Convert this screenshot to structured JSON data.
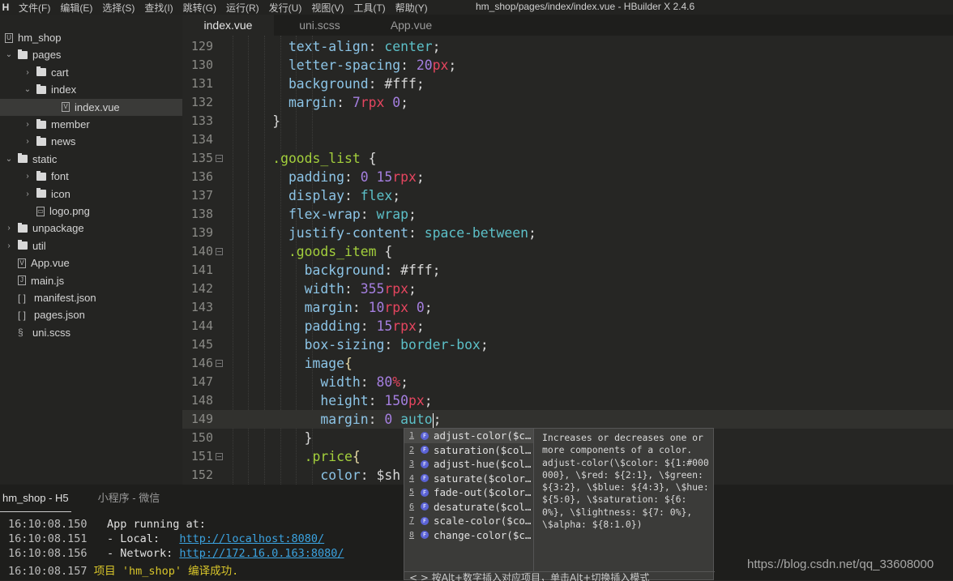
{
  "menubar": {
    "logo": "H",
    "items": [
      "文件(F)",
      "编辑(E)",
      "选择(S)",
      "查找(I)",
      "跳转(G)",
      "运行(R)",
      "发行(U)",
      "视图(V)",
      "工具(T)",
      "帮助(Y)"
    ],
    "title": "hm_shop/pages/index/index.vue - HBuilder X 2.4.6"
  },
  "sidebar": {
    "items": [
      {
        "label": "hm_shop",
        "icon": "project-icon",
        "level": 0,
        "chevron": "",
        "selected": false
      },
      {
        "label": "pages",
        "icon": "folder-open-icon",
        "level": 0,
        "chevron": "down"
      },
      {
        "label": "cart",
        "icon": "folder-icon",
        "level": 1,
        "chevron": "right"
      },
      {
        "label": "index",
        "icon": "folder-open-icon",
        "level": 1,
        "chevron": "down"
      },
      {
        "label": "index.vue",
        "icon": "vue-file-icon",
        "level": 2,
        "chevron": "",
        "selected": true
      },
      {
        "label": "member",
        "icon": "folder-icon",
        "level": 1,
        "chevron": "right"
      },
      {
        "label": "news",
        "icon": "folder-icon",
        "level": 1,
        "chevron": "right"
      },
      {
        "label": "static",
        "icon": "folder-open-icon",
        "level": 0,
        "chevron": "down"
      },
      {
        "label": "font",
        "icon": "folder-icon",
        "level": 1,
        "chevron": "right"
      },
      {
        "label": "icon",
        "icon": "folder-icon",
        "level": 1,
        "chevron": "right"
      },
      {
        "label": "logo.png",
        "icon": "image-file-icon",
        "level": 1,
        "chevron": ""
      },
      {
        "label": "unpackage",
        "icon": "folder-icon",
        "level": 0,
        "chevron": "right"
      },
      {
        "label": "util",
        "icon": "folder-icon",
        "level": 0,
        "chevron": "right"
      },
      {
        "label": "App.vue",
        "icon": "vue-file-icon",
        "level": 0,
        "chevron": ""
      },
      {
        "label": "main.js",
        "icon": "js-file-icon",
        "level": 0,
        "chevron": ""
      },
      {
        "label": "manifest.json",
        "icon": "json-file-icon",
        "level": 0,
        "chevron": ""
      },
      {
        "label": "pages.json",
        "icon": "json-file-icon",
        "level": 0,
        "chevron": ""
      },
      {
        "label": "uni.scss",
        "icon": "scss-file-icon",
        "level": 0,
        "chevron": ""
      }
    ]
  },
  "tabs": [
    {
      "label": "index.vue",
      "active": true
    },
    {
      "label": "uni.scss"
    },
    {
      "label": "App.vue"
    }
  ],
  "editor": {
    "current_line": 149,
    "lines": [
      {
        "n": 129,
        "t": [
          [
            "prop",
            "        text-align"
          ],
          [
            "punc",
            ": "
          ],
          [
            "val",
            "center"
          ],
          [
            "punc",
            ";"
          ]
        ]
      },
      {
        "n": 130,
        "t": [
          [
            "prop",
            "        letter-spacing"
          ],
          [
            "punc",
            ": "
          ],
          [
            "num",
            "20"
          ],
          [
            "unit",
            "px"
          ],
          [
            "punc",
            ";"
          ]
        ]
      },
      {
        "n": 131,
        "t": [
          [
            "prop",
            "        background"
          ],
          [
            "punc",
            ": #fff;"
          ]
        ]
      },
      {
        "n": 132,
        "t": [
          [
            "prop",
            "        margin"
          ],
          [
            "punc",
            ": "
          ],
          [
            "num",
            "7"
          ],
          [
            "unit",
            "rpx"
          ],
          [
            "num",
            " 0"
          ],
          [
            "punc",
            ";"
          ]
        ]
      },
      {
        "n": 133,
        "t": [
          [
            "plain",
            "      }"
          ]
        ]
      },
      {
        "n": 134,
        "t": []
      },
      {
        "n": 135,
        "fold": true,
        "t": [
          [
            "sel",
            "      .goods_list"
          ],
          [
            "plain",
            " {"
          ]
        ]
      },
      {
        "n": 136,
        "t": [
          [
            "prop",
            "        padding"
          ],
          [
            "punc",
            ": "
          ],
          [
            "num",
            "0 15"
          ],
          [
            "unit",
            "rpx"
          ],
          [
            "punc",
            ";"
          ]
        ]
      },
      {
        "n": 137,
        "t": [
          [
            "prop",
            "        display"
          ],
          [
            "punc",
            ": "
          ],
          [
            "val",
            "flex"
          ],
          [
            "punc",
            ";"
          ]
        ]
      },
      {
        "n": 138,
        "t": [
          [
            "prop",
            "        flex-wrap"
          ],
          [
            "punc",
            ": "
          ],
          [
            "val",
            "wrap"
          ],
          [
            "punc",
            ";"
          ]
        ]
      },
      {
        "n": 139,
        "t": [
          [
            "prop",
            "        justify-content"
          ],
          [
            "punc",
            ": "
          ],
          [
            "val",
            "space-between"
          ],
          [
            "punc",
            ";"
          ]
        ]
      },
      {
        "n": 140,
        "fold": true,
        "t": [
          [
            "sel",
            "        .goods_item"
          ],
          [
            "plain",
            " {"
          ]
        ]
      },
      {
        "n": 141,
        "t": [
          [
            "prop",
            "          background"
          ],
          [
            "punc",
            ": #fff;"
          ]
        ]
      },
      {
        "n": 142,
        "t": [
          [
            "prop",
            "          width"
          ],
          [
            "punc",
            ": "
          ],
          [
            "num",
            "355"
          ],
          [
            "unit",
            "rpx"
          ],
          [
            "punc",
            ";"
          ]
        ]
      },
      {
        "n": 143,
        "t": [
          [
            "prop",
            "          margin"
          ],
          [
            "punc",
            ": "
          ],
          [
            "num",
            "10"
          ],
          [
            "unit",
            "rpx"
          ],
          [
            "num",
            " 0"
          ],
          [
            "punc",
            ";"
          ]
        ]
      },
      {
        "n": 144,
        "t": [
          [
            "prop",
            "          padding"
          ],
          [
            "punc",
            ": "
          ],
          [
            "num",
            "15"
          ],
          [
            "unit",
            "rpx"
          ],
          [
            "punc",
            ";"
          ]
        ]
      },
      {
        "n": 145,
        "t": [
          [
            "prop",
            "          box-sizing"
          ],
          [
            "punc",
            ": "
          ],
          [
            "val",
            "border-box"
          ],
          [
            "punc",
            ";"
          ]
        ]
      },
      {
        "n": 146,
        "fold": true,
        "t": [
          [
            "tag",
            "          image"
          ],
          [
            "brace",
            "{"
          ]
        ]
      },
      {
        "n": 147,
        "t": [
          [
            "prop",
            "            width"
          ],
          [
            "punc",
            ": "
          ],
          [
            "num",
            "80"
          ],
          [
            "unit",
            "%"
          ],
          [
            "punc",
            ";"
          ]
        ]
      },
      {
        "n": 148,
        "t": [
          [
            "prop",
            "            height"
          ],
          [
            "punc",
            ": "
          ],
          [
            "num",
            "150"
          ],
          [
            "unit",
            "px"
          ],
          [
            "punc",
            ";"
          ]
        ]
      },
      {
        "n": 149,
        "caret": true,
        "t": [
          [
            "prop",
            "            margin"
          ],
          [
            "punc",
            ": "
          ],
          [
            "num",
            "0 "
          ],
          [
            "val",
            "auto"
          ],
          [
            "caret",
            ""
          ],
          [
            "punc",
            ";"
          ]
        ]
      },
      {
        "n": 150,
        "t": [
          [
            "plain",
            "          }"
          ]
        ]
      },
      {
        "n": 151,
        "fold": true,
        "t": [
          [
            "sel",
            "          .price"
          ],
          [
            "brace",
            "{"
          ]
        ]
      },
      {
        "n": 152,
        "t": [
          [
            "prop",
            "            color"
          ],
          [
            "punc",
            ": $sh"
          ]
        ]
      }
    ]
  },
  "console": {
    "tabs": [
      {
        "label": "hm_shop - H5",
        "active": true
      },
      {
        "label": "小程序 - 微信"
      }
    ],
    "lines": [
      {
        "ts": "16:10:08.150",
        "text": "  App running at:"
      },
      {
        "ts": "16:10:08.151",
        "text": "  - Local:   ",
        "link": "http://localhost:8080/"
      },
      {
        "ts": "16:10:08.156",
        "text": "  - Network: ",
        "link": "http://172.16.0.163:8080/"
      },
      {
        "ts": "16:10:08.157",
        "ok": "项目 'hm_shop' 编译成功."
      }
    ]
  },
  "autocomplete": {
    "items": [
      {
        "n": "1",
        "label": "adjust-color($c…"
      },
      {
        "n": "2",
        "label": "saturation($col…"
      },
      {
        "n": "3",
        "label": "adjust-hue($col…"
      },
      {
        "n": "4",
        "label": "saturate($color…"
      },
      {
        "n": "5",
        "label": "fade-out($color…"
      },
      {
        "n": "6",
        "label": "desaturate($col…"
      },
      {
        "n": "7",
        "label": "scale-color($co…"
      },
      {
        "n": "8",
        "label": "change-color($c…"
      }
    ],
    "doc": "Increases or decreases one or more components of a color.\nadjust-color(\\$color: ${1:#000000}, \\$red: ${2:1}, \\$green: ${3:2}, \\$blue: ${4:3}, \\$hue: ${5:0}, \\$saturation: ${6: 0%}, \\$lightness: ${7: 0%}, \\$alpha: ${8:1.0})",
    "hint": "< > 按Alt+数字插入对应项目，单击Alt+切换插入模式"
  },
  "watermark": "https://blog.csdn.net/qq_33608000"
}
